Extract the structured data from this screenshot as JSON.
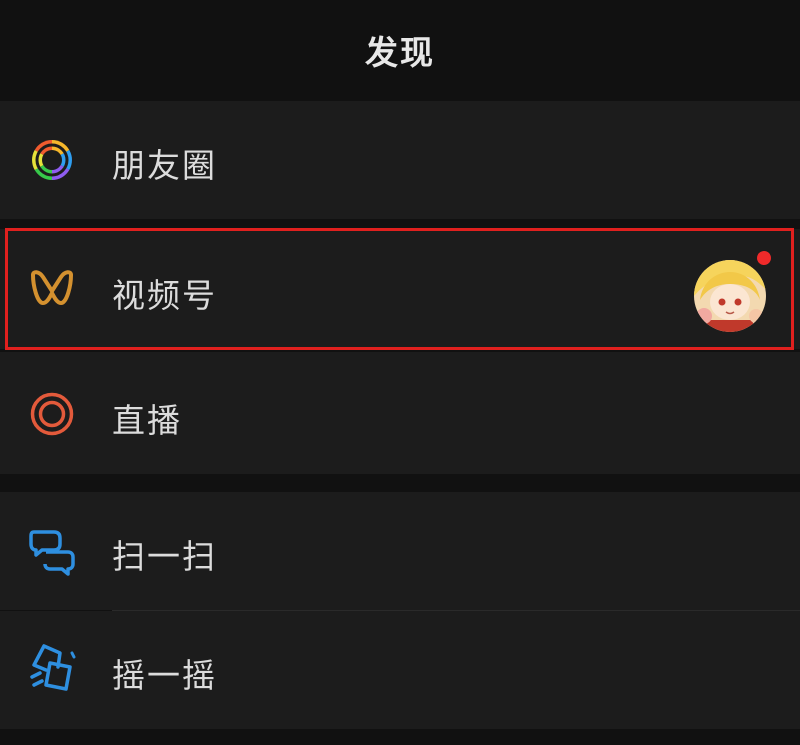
{
  "header": {
    "title": "发现"
  },
  "items": [
    {
      "label": "朋友圈",
      "icon": "moments-icon"
    },
    {
      "label": "视频号",
      "icon": "channels-icon",
      "has_avatar": true,
      "has_red_dot": true
    },
    {
      "label": "直播",
      "icon": "live-icon"
    },
    {
      "label": "扫一扫",
      "icon": "scan-icon"
    },
    {
      "label": "摇一摇",
      "icon": "shake-icon"
    }
  ],
  "colors": {
    "background": "#111111",
    "row": "#1c1c1c",
    "text": "#dcdcdc",
    "highlight": "#e0201e",
    "channels_gold": "#d4912f",
    "live_orange": "#e35a3b",
    "scan_blue": "#2e8fe0",
    "red_dot": "#f02a2a"
  }
}
